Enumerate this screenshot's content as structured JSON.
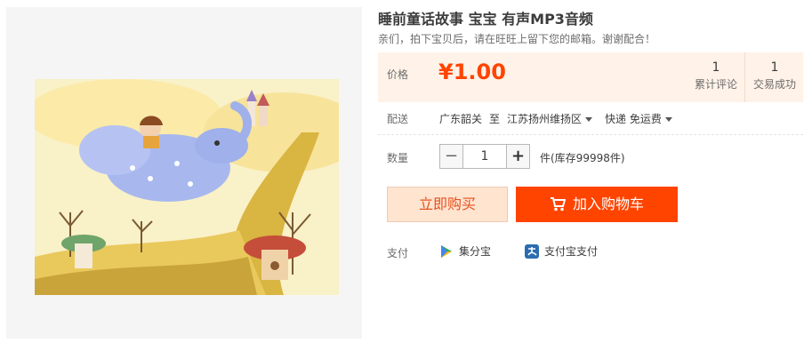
{
  "product": {
    "title": "睡前童话故事 宝宝 有声MP3音频",
    "subtitle": "亲们，拍下宝贝后，请在旺旺上留下您的邮箱。谢谢配合！",
    "image_alt": "cartoon-elephant-illustration"
  },
  "price": {
    "label": "价格",
    "value": "¥1.00",
    "accent_color": "#ff4400"
  },
  "stats": [
    {
      "num": "1",
      "label": "累计评论"
    },
    {
      "num": "1",
      "label": "交易成功"
    }
  ],
  "shipping": {
    "label": "配送",
    "origin": "广东韶关",
    "to": "至",
    "destination": "江苏扬州维扬区",
    "method": "快递 免运费"
  },
  "quantity": {
    "label": "数量",
    "minus": "−",
    "value": "1",
    "plus": "+",
    "stock": "件(库存99998件)"
  },
  "actions": {
    "buy_now": "立即购买",
    "add_to_cart": "加入购物车"
  },
  "payment": {
    "label": "支付",
    "methods": [
      {
        "name": "集分宝",
        "icon": "jifenbao-icon"
      },
      {
        "name": "支付宝支付",
        "icon": "alipay-icon"
      }
    ]
  }
}
